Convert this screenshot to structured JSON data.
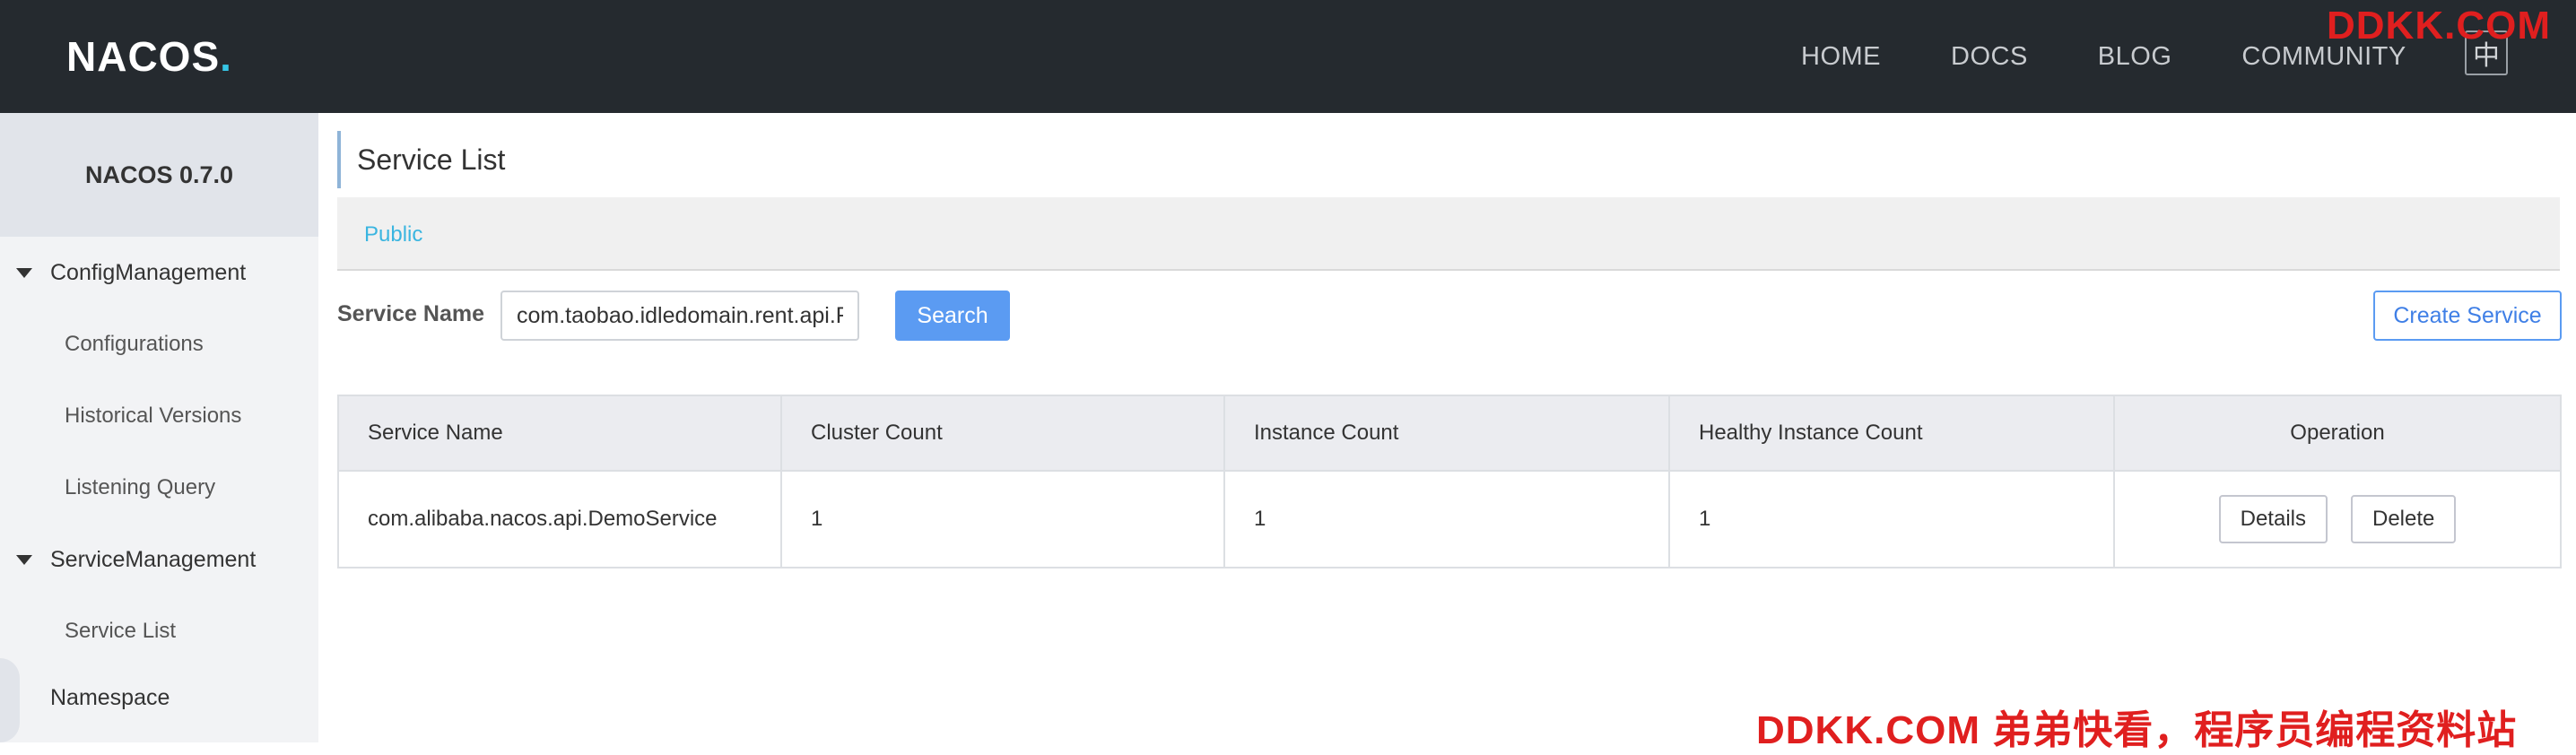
{
  "header": {
    "logo_main": "NACOS",
    "logo_dot": ".",
    "nav": [
      "HOME",
      "DOCS",
      "BLOG",
      "COMMUNITY"
    ],
    "lang_button": "中",
    "watermark_top": "DDKK.COM"
  },
  "sidebar": {
    "version": "NACOS 0.7.0",
    "config_group": "ConfigManagement",
    "config_items": [
      "Configurations",
      "Historical Versions",
      "Listening Query"
    ],
    "service_group": "ServiceManagement",
    "service_items": [
      "Service List"
    ],
    "namespace": "Namespace"
  },
  "main": {
    "title": "Service List",
    "namespace_link": "Public",
    "filter_label": "Service Name",
    "filter_value": "com.taobao.idledomain.rent.api.R",
    "search_label": "Search",
    "create_label": "Create Service"
  },
  "table": {
    "headers": [
      "Service Name",
      "Cluster Count",
      "Instance Count",
      "Healthy Instance Count",
      "Operation"
    ],
    "rows": [
      {
        "service": "com.alibaba.nacos.api.DemoService",
        "cluster": "1",
        "instance": "1",
        "healthy": "1",
        "details": "Details",
        "delete": "Delete"
      }
    ]
  },
  "watermark_bottom": "DDKK.COM 弟弟快看，程序员编程资料站",
  "colors": {
    "header_bg": "#252a2f",
    "sidebar_bg": "#f2f3f5",
    "accent_blue": "#5b9bf2",
    "link_cyan": "#3ab5e0",
    "watermark_red": "#e01f1f"
  }
}
